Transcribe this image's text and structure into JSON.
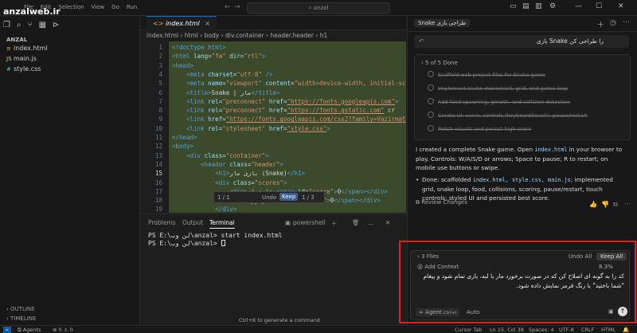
{
  "watermark": "anzalweb.ir",
  "titlebar": {
    "menu": [
      "File",
      "Edit",
      "Selection",
      "View",
      "Go",
      "Run"
    ],
    "search": "anzal"
  },
  "sidebar": {
    "title": "ANZAL",
    "files": [
      {
        "name": "index.html",
        "icon": "html-icon"
      },
      {
        "name": "main.js",
        "icon": "js-icon"
      },
      {
        "name": "style.css",
        "icon": "css-icon"
      }
    ],
    "outline": "OUTLINE",
    "timeline": "TIMELINE"
  },
  "editor": {
    "tab": "index.html",
    "breadcrumb": [
      "index.html",
      "html",
      "body",
      "div.container",
      "header.header",
      "h1"
    ],
    "lines": [
      {
        "n": "1",
        "html": "<span class=\"tg\">&lt;!doctype html&gt;</span>"
      },
      {
        "n": "2",
        "html": "<span class=\"tg\">&lt;html</span> <span class=\"at\">lang</span>=<span class=\"st\">\"fa\"</span> <span class=\"at\">dir</span>=<span class=\"st\">\"rtl\"</span><span class=\"tg\">&gt;</span>"
      },
      {
        "n": "3",
        "html": "<span class=\"tg\">&lt;head&gt;</span>"
      },
      {
        "n": "4",
        "html": "    <span class=\"tg\">&lt;meta</span> <span class=\"at\">charset</span>=<span class=\"st\">\"utf-8\"</span> <span class=\"tg\">/&gt;</span>"
      },
      {
        "n": "5",
        "html": "    <span class=\"tg\">&lt;meta</span> <span class=\"at\">name</span>=<span class=\"st\">\"viewport\"</span> <span class=\"at\">content</span>=<span class=\"st\">\"width=device-width, initial-sc</span>"
      },
      {
        "n": "6",
        "html": "    <span class=\"tg\">&lt;title&gt;</span>Snake | مار<span class=\"tg\">&lt;/title&gt;</span>"
      },
      {
        "n": "7",
        "html": "    <span class=\"tg\">&lt;link</span> <span class=\"at\">rel</span>=<span class=\"st\">\"preconnect\"</span> <span class=\"at\">href</span>=<span class=\"ul\">\"https://fonts.googleapis.com\"</span><span class=\"tg\">&gt;</span>"
      },
      {
        "n": "8",
        "html": "    <span class=\"tg\">&lt;link</span> <span class=\"at\">rel</span>=<span class=\"st\">\"preconnect\"</span> <span class=\"at\">href</span>=<span class=\"ul\">\"https://fonts.gstatic.com\"</span> cr"
      },
      {
        "n": "9",
        "html": "    <span class=\"tg\">&lt;link</span> <span class=\"at\">href</span>=<span class=\"ul\">\"https://fonts.googleapis.com/css2?family=Vazirmat</span>"
      },
      {
        "n": "10",
        "html": "    <span class=\"tg\">&lt;link</span> <span class=\"at\">rel</span>=<span class=\"st\">\"stylesheet\"</span> <span class=\"at\">href</span>=<span class=\"ul\">\"style.css\"</span><span class=\"tg\">&gt;</span>"
      },
      {
        "n": "11",
        "html": "<span class=\"tg\">&lt;/head&gt;</span>"
      },
      {
        "n": "12",
        "html": "<span class=\"tg\">&lt;body&gt;</span>"
      },
      {
        "n": "13",
        "html": "    <span class=\"tg\">&lt;div</span> <span class=\"at\">class</span>=<span class=\"st\">\"container\"</span><span class=\"tg\">&gt;</span>"
      },
      {
        "n": "14",
        "html": "        <span class=\"tg\">&lt;header</span> <span class=\"at\">class</span>=<span class=\"st\">\"header\"</span><span class=\"tg\">&gt;</span>"
      },
      {
        "n": "15",
        "html": "            <span class=\"tg\">&lt;h1&gt;</span>بازی مار (Snake)<span class=\"tg\">&lt;/h1&gt;</span>"
      },
      {
        "n": "16",
        "html": "            <span class=\"tg\">&lt;div</span> <span class=\"at\">class</span>=<span class=\"st\">\"scores\"</span><span class=\"tg\">&gt;</span>"
      },
      {
        "n": "17",
        "html": "                <span class=\"tg\">&lt;div&gt;</span>امتیاز: <span class=\"tg\">&lt;span</span> <span class=\"at\">id</span>=<span class=\"st\">\"score\"</span><span class=\"tg\">&gt;</span>0<span class=\"tg\">&lt;/span&gt;&lt;/div&gt;</span>"
      },
      {
        "n": "18",
        "html": "                <span class=\"tg\">&lt;div&gt;</span>رکورد: <span class=\"tg\">&lt;span</span> <span class=\"at\">id</span>=<span class=\"st\">\"best\"</span><span class=\"tg\">&gt;</span>0<span class=\"tg\">&lt;/span&gt;&lt;/div&gt;</span>"
      },
      {
        "n": "19",
        "html": "            <span class=\"tg\">&lt;/div&gt;</span>"
      },
      {
        "n": "20",
        "html": "        <span class=\"tg\">&lt;/header&gt;</span>"
      }
    ],
    "find": {
      "count1": "1 / 1",
      "undo": "Undo",
      "keep": "Keep",
      "count2": "1 / 3"
    }
  },
  "panel": {
    "tabs": [
      "Problems",
      "Output",
      "Terminal"
    ],
    "active_tab": "Terminal",
    "shell": "powershell",
    "lines": [
      "PS E:\\لن وب\\anzal> start index.html",
      "PS E:\\لن وب\\anzal> "
    ],
    "hint": "Ctrl+K to generate a command"
  },
  "chat": {
    "tab": "Snake طراحی بازی",
    "prompt": "بازی Snake را طراحی کن",
    "todo_header": "5 of 5 Done",
    "todos": [
      "Scaffold web project files for Snake game",
      "Implement snake movement, grid, and game loop",
      "Add food spawning, growth, and collision detection",
      "Create UI: score, controls (keyboard/touch), pause/restart",
      "Polish visuals and persist high score"
    ],
    "message_a": "I created a complete Snake game. Open",
    "message_code": "index.html",
    "message_b": "in your browser to play. Controls: W/A/S/D or arrows; Space to pause; R to restart; on mobile use buttons or swipe.",
    "bullet_a": "Done: scaffolded",
    "bullet_code": "index.html, style.css, main.js",
    "bullet_b": "; implemented grid, snake loop, food, collisions, scoring, pause/restart, touch controls; styled UI and persisted best score.",
    "review": "Review Changes"
  },
  "composer": {
    "files": "3 Files",
    "undo_all": "Undo All",
    "keep_all": "Keep All",
    "add_context": "@ Add Context",
    "percent": "8.3%",
    "text": "کد را به گونه ای اصلاح کن که در صورت برخورد مار با لبه، بازی تمام شود و پیغام \"شما باختید\" با رنگ قرمز نمایش داده شود.",
    "agent": "Agent",
    "shortcut": "Ctrl+I",
    "model": "Auto"
  },
  "statusbar": {
    "left": "Agents",
    "errors": "0",
    "warnings": "0",
    "cursor_tab": "Cursor Tab",
    "position": "Ln 15, Col 38",
    "spaces": "Spaces: 4",
    "encoding": "UTF-8",
    "eol": "CRLF",
    "lang": "HTML"
  }
}
